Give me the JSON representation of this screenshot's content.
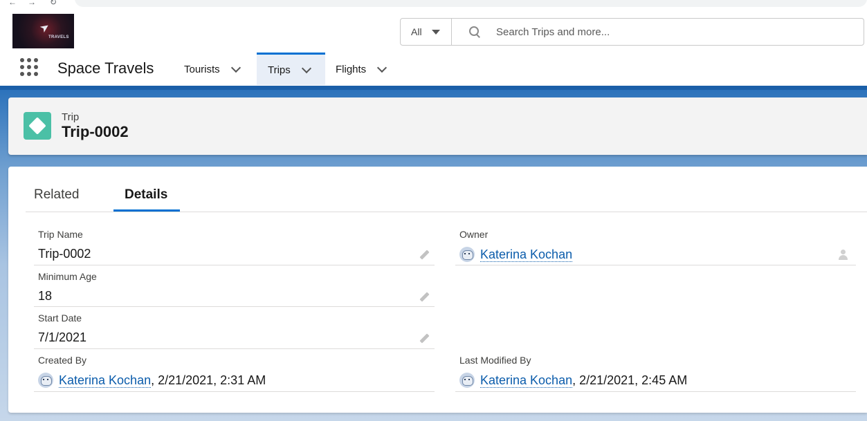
{
  "header": {
    "logo_text": "TRAVELS",
    "search": {
      "scope": "All",
      "placeholder": "Search Trips and more..."
    },
    "app_name": "Space Travels",
    "nav_tabs": [
      {
        "label": "Tourists",
        "active": false
      },
      {
        "label": "Trips",
        "active": true
      },
      {
        "label": "Flights",
        "active": false
      }
    ]
  },
  "record": {
    "object_type": "Trip",
    "name": "Trip-0002",
    "icon": "trip-diamond-icon",
    "icon_color": "#4bc0a6"
  },
  "tabs": {
    "related": "Related",
    "details": "Details",
    "active": "Details"
  },
  "details": {
    "trip_name": {
      "label": "Trip Name",
      "value": "Trip-0002"
    },
    "owner": {
      "label": "Owner",
      "value": "Katerina Kochan"
    },
    "minimum_age": {
      "label": "Minimum Age",
      "value": "18"
    },
    "start_date": {
      "label": "Start Date",
      "value": "7/1/2021"
    },
    "created_by": {
      "label": "Created By",
      "user": "Katerina Kochan",
      "timestamp": ", 2/21/2021, 2:31 AM"
    },
    "last_modified_by": {
      "label": "Last Modified By",
      "user": "Katerina Kochan",
      "timestamp": ", 2/21/2021, 2:45 AM"
    }
  },
  "colors": {
    "brand_blue": "#0070d2",
    "header_band": "#1b5fa8",
    "link": "#0b5cab"
  }
}
